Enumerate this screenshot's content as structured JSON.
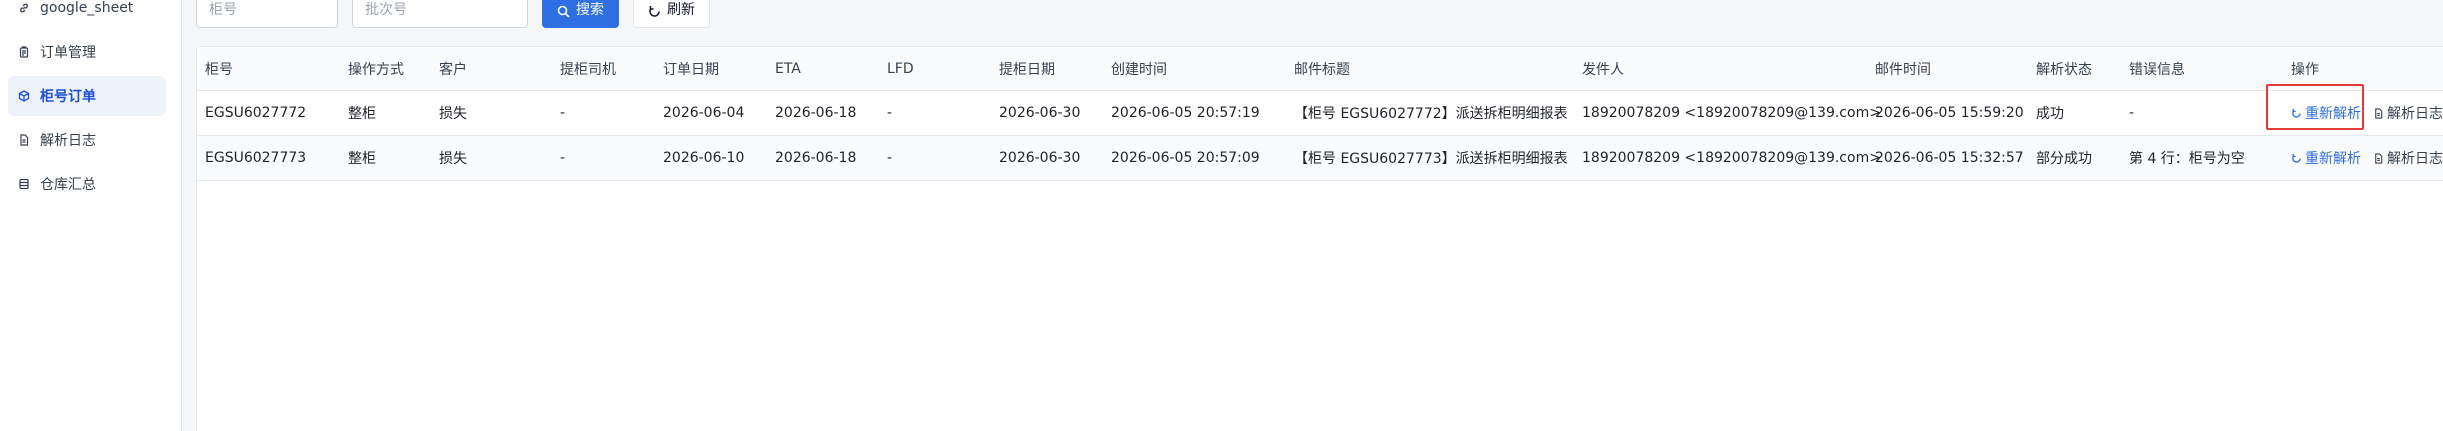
{
  "sidebar": {
    "items": [
      {
        "label": "google_sheet",
        "icon": "link-icon",
        "active": false
      },
      {
        "label": "订单管理",
        "icon": "clipboard-icon",
        "active": false
      },
      {
        "label": "柜号订单",
        "icon": "box-icon",
        "active": true
      },
      {
        "label": "解析日志",
        "icon": "document-icon",
        "active": false
      },
      {
        "label": "仓库汇总",
        "icon": "database-icon",
        "active": false
      }
    ]
  },
  "toolbar": {
    "container_placeholder": "柜号",
    "batch_placeholder": "批次号",
    "search_label": "搜索",
    "refresh_label": "刷新"
  },
  "table": {
    "columns": [
      "柜号",
      "操作方式",
      "客户",
      "提柜司机",
      "订单日期",
      "ETA",
      "LFD",
      "提柜日期",
      "创建时间",
      "邮件标题",
      "发件人",
      "邮件时间",
      "解析状态",
      "错误信息",
      "操作"
    ],
    "rows": [
      {
        "container_no": "EGSU6027772",
        "operation": "整柜",
        "customer": "损失",
        "driver": "-",
        "order_date": "2026-06-04",
        "eta": "2026-06-18",
        "lfd": "-",
        "pickup_date": "2026-06-30",
        "created_at": "2026-06-05 20:57:19",
        "mail_subject": "【柜号 EGSU6027772】派送拆柜明细报表",
        "sender": "18920078209 <18920078209@139.com>",
        "mail_time": "2026-06-05 15:59:20",
        "parse_status": "成功",
        "error": "-",
        "action_reparse": "重新解析",
        "action_log": "解析日志"
      },
      {
        "container_no": "EGSU6027773",
        "operation": "整柜",
        "customer": "损失",
        "driver": "-",
        "order_date": "2026-06-10",
        "eta": "2026-06-18",
        "lfd": "-",
        "pickup_date": "2026-06-30",
        "created_at": "2026-06-05 20:57:09",
        "mail_subject": "【柜号 EGSU6027773】派送拆柜明细报表",
        "sender": "18920078209 <18920078209@139.com>",
        "mail_time": "2026-06-05 15:32:57",
        "parse_status": "部分成功",
        "error": "第 4 行：柜号为空",
        "action_reparse": "重新解析",
        "action_log": "解析日志"
      }
    ]
  },
  "colors": {
    "primary": "#2f6fe4",
    "highlight": "#e23b3b",
    "active_bg": "#eef2fb"
  }
}
